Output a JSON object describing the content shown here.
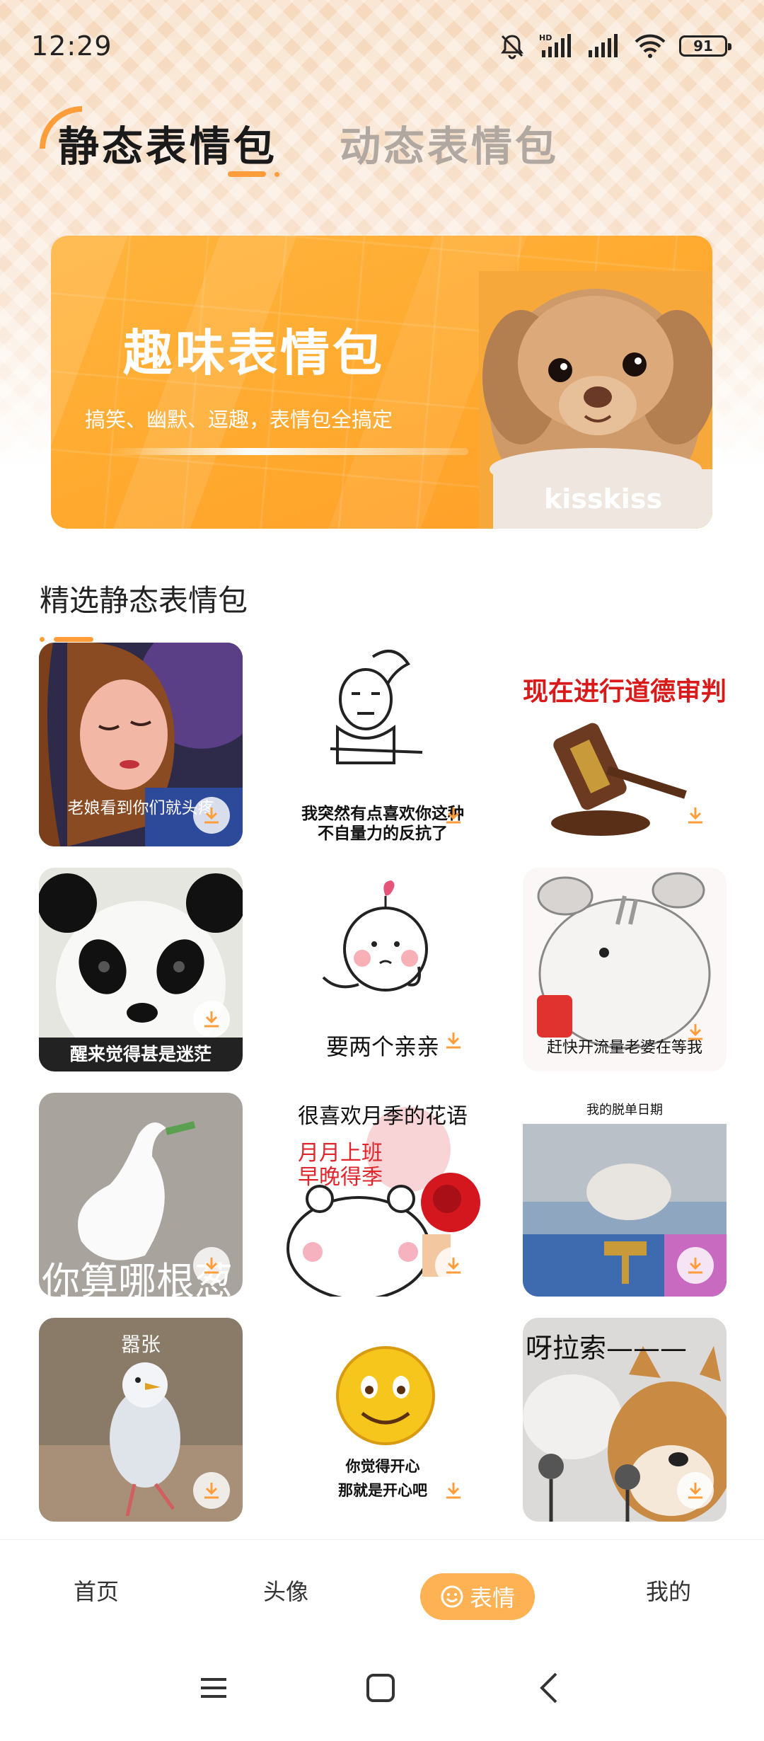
{
  "status_bar": {
    "time": "12:29",
    "battery": "91",
    "icons": [
      "bell-muted-icon",
      "hd-signal-icon",
      "signal-icon",
      "wifi-icon",
      "battery-icon"
    ]
  },
  "tabs": [
    {
      "label": "静态表情包",
      "active": true
    },
    {
      "label": "动态表情包",
      "active": false
    }
  ],
  "banner": {
    "title": "趣味表情包",
    "subtitle": "搞笑、幽默、逗趣，表情包全搞定",
    "image_label": "kisskiss"
  },
  "section": {
    "title": "精选静态表情包"
  },
  "stickers": [
    {
      "caption": "老娘看到你们就头疼"
    },
    {
      "caption": "我突然有点喜欢你这种",
      "caption2": "不自量力的反抗了"
    },
    {
      "caption": "现在进行道德审判"
    },
    {
      "caption": "醒来觉得甚是迷茫"
    },
    {
      "caption": "要两个亲亲"
    },
    {
      "caption": "赶快开流量老婆在等我"
    },
    {
      "caption": "你算哪根葱"
    },
    {
      "caption": "很喜欢月季的花语",
      "caption2": "月月上班",
      "caption3": "早晚得季"
    },
    {
      "caption": "我的脱单日期"
    },
    {
      "caption": "嚣张"
    },
    {
      "caption": "你觉得开心",
      "caption2": "那就是开心吧"
    },
    {
      "caption": "呀拉索———"
    }
  ],
  "bottom_nav": [
    {
      "label": "首页"
    },
    {
      "label": "头像"
    },
    {
      "label": "表情",
      "active": true
    },
    {
      "label": "我的"
    }
  ],
  "colors": {
    "accent": "#ff9d3a",
    "banner": "#ffab32",
    "nav_active": "#ffb253"
  }
}
